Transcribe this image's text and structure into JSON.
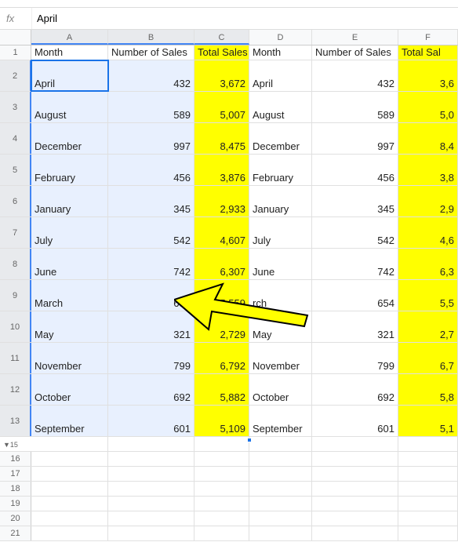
{
  "formula_bar": {
    "fx_label": "fx",
    "value": "April"
  },
  "columns": [
    "A",
    "B",
    "C",
    "D",
    "E",
    "F"
  ],
  "headers": {
    "A": "Month",
    "B": "Number of Sales",
    "C": "Total Sales",
    "D": "Month",
    "E": "Number of Sales",
    "F": "Total Sal"
  },
  "rows": [
    {
      "num": 2,
      "A": "April",
      "B": "432",
      "C": "3,672",
      "D": "April",
      "E": "432",
      "F": "3,6"
    },
    {
      "num": 3,
      "A": "August",
      "B": "589",
      "C": "5,007",
      "D": "August",
      "E": "589",
      "F": "5,0"
    },
    {
      "num": 4,
      "A": "December",
      "B": "997",
      "C": "8,475",
      "D": "December",
      "E": "997",
      "F": "8,4"
    },
    {
      "num": 5,
      "A": "February",
      "B": "456",
      "C": "3,876",
      "D": "February",
      "E": "456",
      "F": "3,8"
    },
    {
      "num": 6,
      "A": "January",
      "B": "345",
      "C": "2,933",
      "D": "January",
      "E": "345",
      "F": "2,9"
    },
    {
      "num": 7,
      "A": "July",
      "B": "542",
      "C": "4,607",
      "D": "July",
      "E": "542",
      "F": "4,6"
    },
    {
      "num": 8,
      "A": "June",
      "B": "742",
      "C": "6,307",
      "D": "June",
      "E": "742",
      "F": "6,3"
    },
    {
      "num": 9,
      "A": "March",
      "B": "654",
      "C": "5,559",
      "D": "rch",
      "E": "654",
      "F": "5,5"
    },
    {
      "num": 10,
      "A": "May",
      "B": "321",
      "C": "2,729",
      "D": "May",
      "E": "321",
      "F": "2,7"
    },
    {
      "num": 11,
      "A": "November",
      "B": "799",
      "C": "6,792",
      "D": "November",
      "E": "799",
      "F": "6,7"
    },
    {
      "num": 12,
      "A": "October",
      "B": "692",
      "C": "5,882",
      "D": "October",
      "E": "692",
      "F": "5,8"
    },
    {
      "num": 13,
      "A": "September",
      "B": "601",
      "C": "5,109",
      "D": "September",
      "E": "601",
      "F": "5,1"
    }
  ],
  "empty_rows": [
    15,
    16,
    17,
    18,
    19,
    20,
    21
  ],
  "header_row_label": "1"
}
